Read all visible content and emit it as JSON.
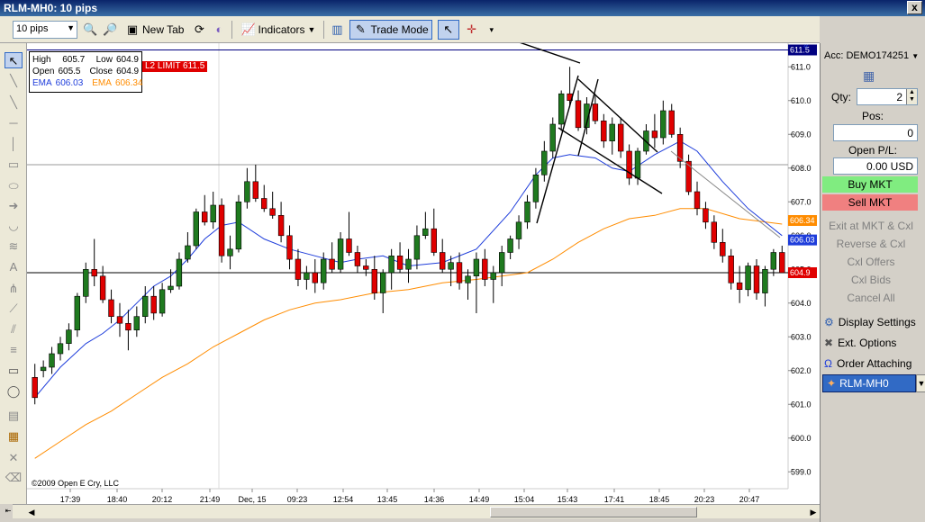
{
  "window": {
    "title": "RLM-MH0: 10 pips",
    "close": "x"
  },
  "toolbar": {
    "interval_value": "10 pips",
    "new_tab": "New Tab",
    "indicators": "Indicators",
    "trade_mode": "Trade Mode"
  },
  "infobox": {
    "high_label": "High",
    "high": "605.7",
    "low_label": "Low",
    "low": "604.9",
    "open_label": "Open",
    "open": "605.5",
    "close_label": "Close",
    "close": "604.9",
    "ema1_label": "EMA",
    "ema1": "606.03",
    "ema2_label": "EMA",
    "ema2": "606.34"
  },
  "limit_tag": "L2 LIMIT 611.5",
  "copyright": "©2009 Open E Cry, LLC",
  "panel": {
    "account": "Acc: DEMO174251",
    "qty_label": "Qty:",
    "qty_value": "2",
    "pos_label": "Pos:",
    "pos_value": "0",
    "pl_label": "Open P/L:",
    "pl_value": "0.00 USD",
    "buy": "Buy MKT",
    "sell": "Sell MKT",
    "exit": "Exit at MKT & Cxl",
    "reverse": "Reverse & Cxl",
    "cxl_offers": "Cxl Offers",
    "cxl_bids": "Cxl Bids",
    "cancel_all": "Cancel All",
    "display_settings": "Display Settings",
    "ext_options": "Ext. Options",
    "order_attaching": "Order Attaching",
    "symbol": "RLM-MH0"
  },
  "chart_data": {
    "type": "candlestick",
    "ylim": [
      598.5,
      611.7
    ],
    "yticks": [
      599,
      600,
      601,
      602,
      603,
      604,
      605,
      606,
      607,
      608,
      609,
      610,
      611
    ],
    "xtick_labels": [
      "17:39",
      "18:40",
      "20:12",
      "21:49",
      "Dec, 15",
      "09:23",
      "12:54",
      "13:45",
      "14:36",
      "14:49",
      "15:04",
      "15:43",
      "17:41",
      "18:45",
      "20:23",
      "20:47"
    ],
    "price_tags": [
      {
        "value": 611.5,
        "label": "611.5",
        "color": "#000080"
      },
      {
        "value": 606.34,
        "label": "606.34",
        "color": "#ff8c00"
      },
      {
        "value": 606.03,
        "label": "606.03",
        "color": "#1e3ddb"
      },
      {
        "value": 604.9,
        "label": "604.9",
        "color": "#e00000"
      }
    ],
    "hlines": [
      {
        "value": 611.5,
        "color": "#000080"
      },
      {
        "value": 608.1,
        "color": "#999999"
      },
      {
        "value": 604.9,
        "color": "#000000"
      }
    ],
    "candles": [
      [
        601.8,
        602.2,
        601.0,
        601.2
      ],
      [
        602.0,
        602.3,
        601.8,
        602.1
      ],
      [
        602.1,
        602.7,
        601.9,
        602.5
      ],
      [
        602.5,
        603.0,
        602.3,
        602.8
      ],
      [
        602.8,
        603.4,
        602.6,
        603.2
      ],
      [
        603.2,
        604.3,
        603.0,
        604.2
      ],
      [
        604.2,
        605.2,
        604.0,
        605.0
      ],
      [
        605.0,
        605.9,
        604.5,
        604.8
      ],
      [
        604.8,
        605.1,
        604.0,
        604.1
      ],
      [
        604.1,
        604.4,
        603.4,
        603.6
      ],
      [
        603.6,
        604.0,
        603.0,
        603.4
      ],
      [
        603.4,
        603.8,
        602.6,
        603.2
      ],
      [
        603.2,
        603.9,
        603.0,
        603.6
      ],
      [
        603.6,
        604.5,
        603.4,
        604.2
      ],
      [
        604.2,
        604.5,
        603.5,
        603.7
      ],
      [
        603.7,
        604.6,
        603.6,
        604.4
      ],
      [
        604.4,
        605.0,
        604.3,
        604.5
      ],
      [
        604.5,
        605.5,
        604.4,
        605.3
      ],
      [
        605.3,
        606.1,
        605.2,
        605.7
      ],
      [
        605.7,
        606.8,
        605.6,
        606.7
      ],
      [
        606.7,
        607.2,
        606.3,
        606.4
      ],
      [
        606.4,
        607.3,
        606.2,
        606.9
      ],
      [
        606.9,
        607.1,
        605.2,
        605.4
      ],
      [
        605.4,
        606.0,
        605.0,
        605.6
      ],
      [
        605.6,
        607.2,
        605.5,
        607.0
      ],
      [
        607.0,
        608.0,
        606.8,
        607.6
      ],
      [
        607.6,
        608.1,
        607.0,
        607.1
      ],
      [
        607.1,
        607.5,
        606.7,
        606.8
      ],
      [
        606.8,
        607.3,
        606.5,
        606.6
      ],
      [
        606.6,
        607.0,
        605.8,
        606.0
      ],
      [
        606.0,
        606.3,
        605.0,
        605.3
      ],
      [
        605.3,
        605.6,
        604.5,
        604.7
      ],
      [
        604.7,
        605.1,
        604.4,
        604.9
      ],
      [
        604.9,
        605.3,
        604.3,
        604.6
      ],
      [
        604.6,
        605.5,
        604.4,
        605.3
      ],
      [
        605.3,
        605.8,
        604.9,
        605.0
      ],
      [
        605.0,
        606.1,
        604.9,
        605.9
      ],
      [
        605.9,
        606.7,
        605.4,
        605.5
      ],
      [
        605.5,
        605.7,
        604.9,
        605.1
      ],
      [
        605.1,
        605.3,
        604.8,
        605.0
      ],
      [
        605.0,
        605.4,
        604.1,
        604.3
      ],
      [
        604.3,
        605.0,
        603.7,
        604.9
      ],
      [
        604.9,
        605.6,
        604.4,
        605.4
      ],
      [
        605.4,
        605.8,
        604.9,
        605.0
      ],
      [
        605.0,
        605.6,
        604.6,
        605.3
      ],
      [
        605.3,
        606.3,
        605.0,
        606.0
      ],
      [
        606.0,
        606.7,
        605.9,
        606.2
      ],
      [
        606.2,
        606.8,
        605.4,
        605.5
      ],
      [
        605.5,
        605.9,
        604.9,
        605.0
      ],
      [
        605.0,
        605.4,
        604.5,
        605.2
      ],
      [
        605.2,
        605.5,
        604.4,
        604.6
      ],
      [
        604.6,
        605.0,
        604.1,
        604.8
      ],
      [
        604.8,
        605.5,
        603.7,
        605.3
      ],
      [
        605.3,
        605.6,
        604.5,
        604.7
      ],
      [
        604.7,
        605.1,
        604.0,
        604.9
      ],
      [
        604.9,
        605.7,
        604.5,
        605.5
      ],
      [
        605.5,
        606.0,
        605.3,
        605.9
      ],
      [
        605.9,
        606.6,
        605.6,
        606.4
      ],
      [
        606.4,
        607.2,
        606.2,
        607.0
      ],
      [
        607.0,
        608.0,
        606.8,
        607.8
      ],
      [
        607.8,
        608.8,
        607.6,
        608.5
      ],
      [
        608.5,
        609.5,
        608.3,
        609.3
      ],
      [
        609.3,
        610.3,
        609.1,
        610.2
      ],
      [
        610.2,
        611.0,
        609.8,
        610.0
      ],
      [
        610.0,
        610.3,
        609.1,
        609.2
      ],
      [
        609.2,
        610.1,
        609.0,
        609.9
      ],
      [
        609.9,
        610.2,
        609.3,
        609.4
      ],
      [
        609.4,
        609.6,
        608.6,
        608.8
      ],
      [
        608.8,
        609.5,
        608.4,
        609.3
      ],
      [
        609.3,
        609.5,
        608.3,
        608.5
      ],
      [
        608.5,
        608.7,
        607.5,
        607.7
      ],
      [
        607.7,
        608.6,
        607.5,
        608.5
      ],
      [
        608.5,
        609.3,
        608.4,
        609.1
      ],
      [
        609.1,
        609.6,
        608.6,
        608.9
      ],
      [
        608.9,
        610.0,
        608.7,
        609.7
      ],
      [
        609.7,
        609.9,
        608.9,
        609.0
      ],
      [
        609.0,
        609.2,
        608.0,
        608.2
      ],
      [
        608.2,
        608.4,
        607.2,
        607.3
      ],
      [
        607.3,
        607.6,
        606.6,
        606.8
      ],
      [
        606.8,
        607.0,
        606.2,
        606.4
      ],
      [
        606.4,
        606.6,
        605.6,
        605.8
      ],
      [
        605.8,
        606.2,
        605.2,
        605.4
      ],
      [
        605.4,
        605.6,
        604.4,
        604.6
      ],
      [
        604.6,
        605.1,
        604.0,
        604.4
      ],
      [
        604.4,
        605.2,
        604.2,
        605.1
      ],
      [
        605.1,
        605.3,
        604.1,
        604.3
      ],
      [
        604.3,
        605.1,
        603.9,
        605.0
      ],
      [
        605.0,
        605.6,
        604.8,
        605.5
      ],
      [
        605.5,
        605.7,
        604.9,
        604.9
      ]
    ],
    "ema_fast": [
      601.2,
      602.1,
      602.8,
      603.1,
      603.5,
      604.0,
      604.5,
      604.8,
      605.3,
      605.9,
      606.3,
      606.4,
      605.9,
      605.6,
      605.4,
      605.2,
      605.3,
      605.4,
      605.1,
      605.2,
      605.6,
      606.7,
      607.8,
      608.3,
      608.4,
      608.3,
      608.0,
      607.9,
      608.4,
      608.8,
      608.5,
      607.6,
      606.8,
      606.0
    ],
    "ema_fast_x": [
      0,
      3,
      6,
      8,
      10,
      12,
      14,
      16,
      18,
      20,
      22,
      24,
      27,
      30,
      33,
      36,
      38,
      41,
      44,
      48,
      52,
      56,
      59,
      61,
      63,
      66,
      68,
      70,
      73,
      76,
      78,
      81,
      84,
      88
    ],
    "ema_slow": [
      599.4,
      599.9,
      600.4,
      600.8,
      601.3,
      601.8,
      602.2,
      602.7,
      603.1,
      603.5,
      603.8,
      604.0,
      604.1,
      604.3,
      604.4,
      604.6,
      604.7,
      604.8,
      604.9,
      605.3,
      605.8,
      606.2,
      606.5,
      606.6,
      606.8,
      606.8,
      606.5,
      606.34
    ],
    "ema_slow_x": [
      0,
      3,
      6,
      9,
      12,
      15,
      18,
      21,
      24,
      27,
      30,
      33,
      36,
      40,
      44,
      48,
      52,
      55,
      58,
      61,
      64,
      67,
      70,
      73,
      76,
      79,
      83,
      88
    ]
  }
}
